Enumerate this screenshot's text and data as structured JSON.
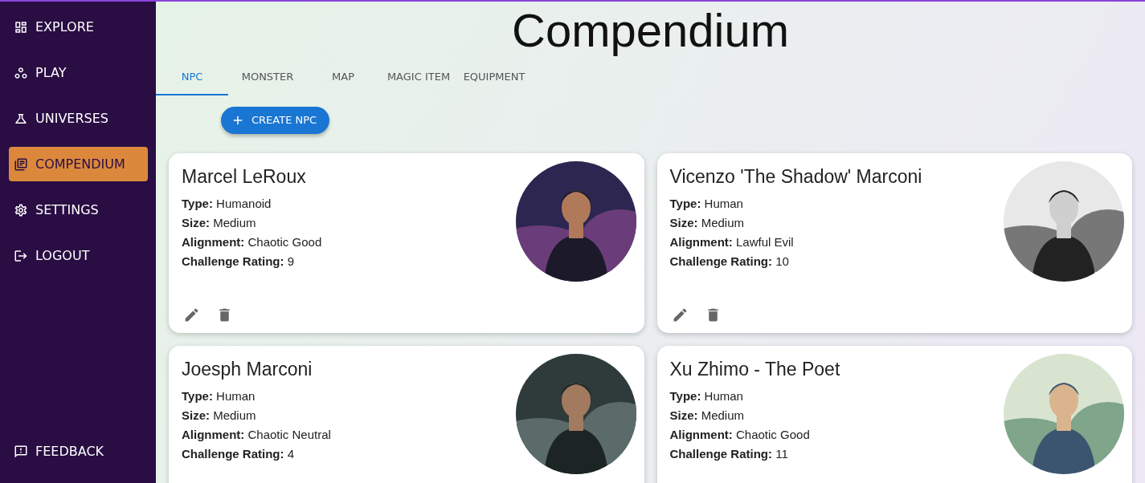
{
  "sidebar": {
    "items": [
      {
        "label": "EXPLORE",
        "selected": false
      },
      {
        "label": "PLAY",
        "selected": false
      },
      {
        "label": "UNIVERSES",
        "selected": false
      },
      {
        "label": "COMPENDIUM",
        "selected": true
      },
      {
        "label": "SETTINGS",
        "selected": false
      },
      {
        "label": "LOGOUT",
        "selected": false
      }
    ],
    "footer": {
      "label": "FEEDBACK"
    }
  },
  "title": "Compendium",
  "tabs": [
    {
      "label": "NPC",
      "selected": true
    },
    {
      "label": "MONSTER",
      "selected": false
    },
    {
      "label": "MAP",
      "selected": false
    },
    {
      "label": "MAGIC ITEM",
      "selected": false
    },
    {
      "label": "EQUIPMENT",
      "selected": false
    }
  ],
  "create_button": {
    "label": "CREATE NPC"
  },
  "cards": [
    {
      "name": "Marcel LeRoux",
      "fields": [
        {
          "label": "Type:",
          "value": "Humanoid"
        },
        {
          "label": "Size:",
          "value": "Medium"
        },
        {
          "label": "Alignment:",
          "value": "Chaotic Good"
        },
        {
          "label": "Challenge Rating:",
          "value": "9"
        }
      ]
    },
    {
      "name": "Vicenzo 'The Shadow' Marconi",
      "fields": [
        {
          "label": "Type:",
          "value": "Human"
        },
        {
          "label": "Size:",
          "value": "Medium"
        },
        {
          "label": "Alignment:",
          "value": "Lawful Evil"
        },
        {
          "label": "Challenge Rating:",
          "value": "10"
        }
      ]
    },
    {
      "name": "Joesph Marconi",
      "fields": [
        {
          "label": "Type:",
          "value": "Human"
        },
        {
          "label": "Size:",
          "value": "Medium"
        },
        {
          "label": "Alignment:",
          "value": "Chaotic Neutral"
        },
        {
          "label": "Challenge Rating:",
          "value": "4"
        }
      ]
    },
    {
      "name": "Xu Zhimo - The Poet",
      "fields": [
        {
          "label": "Type:",
          "value": "Human"
        },
        {
          "label": "Size:",
          "value": "Medium"
        },
        {
          "label": "Alignment:",
          "value": "Chaotic Good"
        },
        {
          "label": "Challenge Rating:",
          "value": "11"
        }
      ]
    }
  ]
}
